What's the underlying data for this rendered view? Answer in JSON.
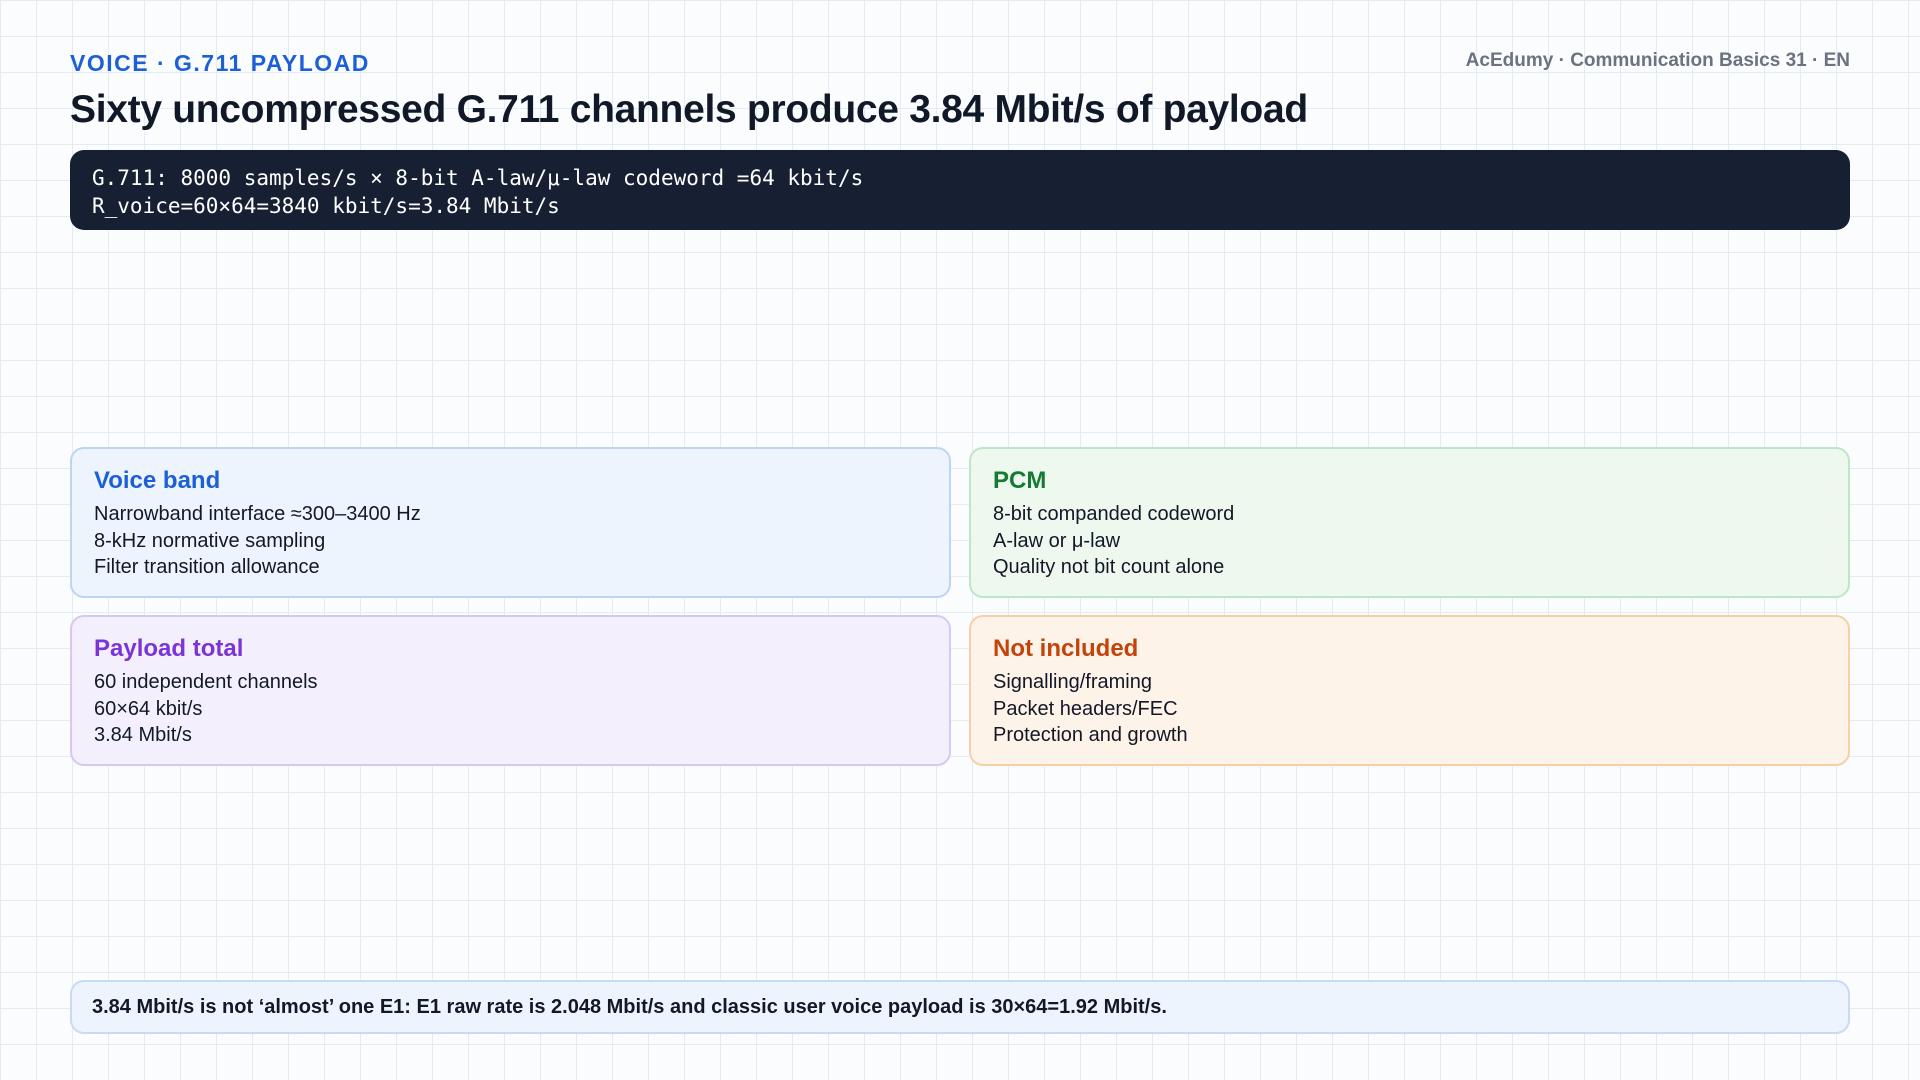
{
  "header": {
    "eyebrow": "VOICE · G.711 PAYLOAD",
    "brand": "AcEdumy · Communication Basics 31 · EN",
    "title": "Sixty uncompressed G.711 channels produce 3.84 Mbit/s of payload"
  },
  "formula": {
    "line1": "G.711: 8000 samples/s × 8-bit A-law/μ-law codeword =64 kbit/s",
    "line2": "R_voice=60×64=3840 kbit/s=3.84 Mbit/s"
  },
  "cards": [
    {
      "title": "Voice band",
      "color": "#1d5fd6",
      "lines": [
        "Narrowband interface ≈300–3400 Hz",
        "8-kHz normative sampling",
        "Filter transition allowance"
      ]
    },
    {
      "title": "PCM",
      "color": "#177a34",
      "lines": [
        "8-bit companded codeword",
        "A-law or μ-law",
        "Quality not bit count alone"
      ]
    },
    {
      "title": "Payload total",
      "color": "#7b34d6",
      "lines": [
        "60 independent channels",
        "60×64 kbit/s",
        "3.84 Mbit/s"
      ]
    },
    {
      "title": "Not included",
      "color": "#c4430b",
      "lines": [
        "Signalling/framing",
        "Packet headers/FEC",
        "Protection and growth"
      ]
    }
  ],
  "note": "3.84 Mbit/s is not ‘almost’ one E1: E1 raw rate is 2.048 Mbit/s and classic user voice payload is 30×64=1.92 Mbit/s."
}
